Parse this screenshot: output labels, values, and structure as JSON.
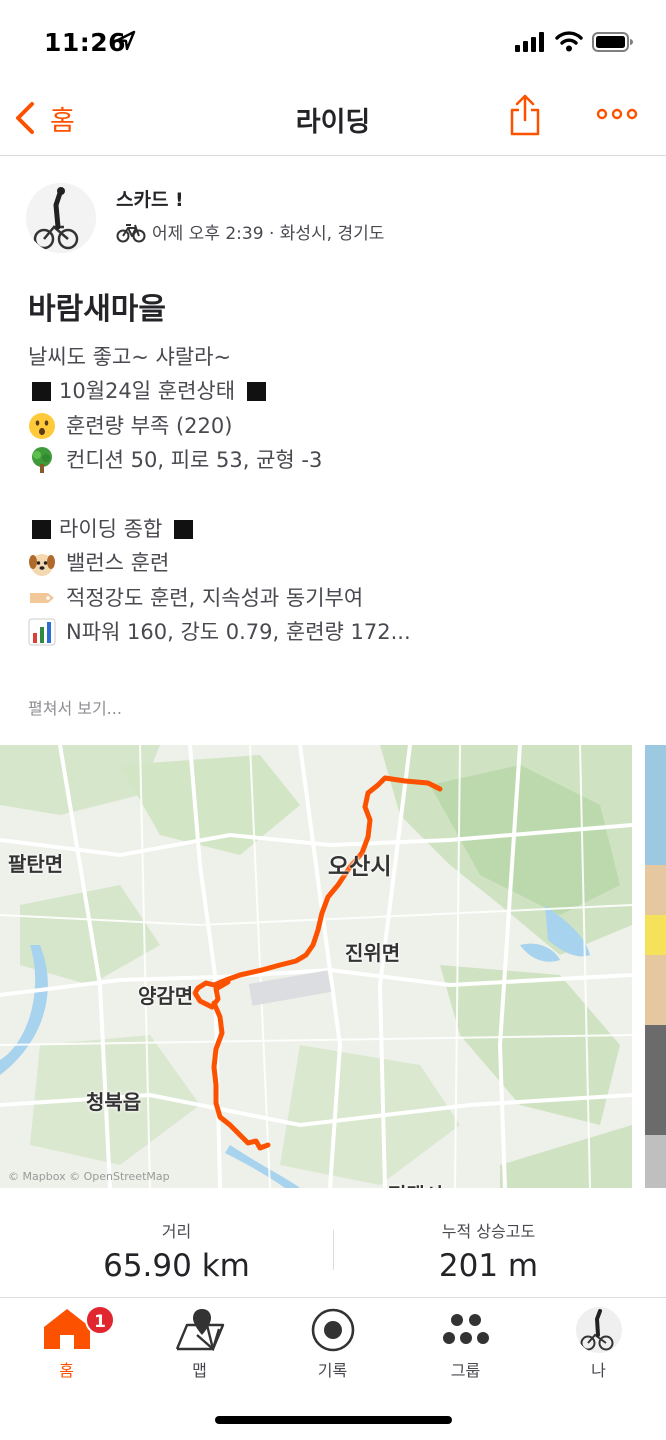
{
  "status_bar": {
    "time": "11:26"
  },
  "nav": {
    "back_label": "홈",
    "title": "라이딩"
  },
  "activity": {
    "athlete_name": "스카드 !",
    "meta": "어제 오후 2:39 · 화성시, 경기도",
    "title": "바람새마을",
    "description": [
      {
        "icon": "",
        "text": "날씨도 좋고~ 샤랄라~"
      },
      {
        "icon": "black-square",
        "text": "10월24일 훈련상태",
        "trail": true
      },
      {
        "icon": "hushed-face-emoji",
        "text": "훈련량 부족 (220)"
      },
      {
        "icon": "tree-emoji",
        "text": "컨디션 50, 피로 53, 균형 -3"
      },
      {
        "icon": "blank",
        "text": ""
      },
      {
        "icon": "black-square",
        "text": "라이딩 종합",
        "trail": true
      },
      {
        "icon": "dog-emoji",
        "text": "밸런스 훈련"
      },
      {
        "icon": "tag-emoji",
        "text": "적정강도 훈련, 지속성과 동기부여"
      },
      {
        "icon": "bar-chart-emoji",
        "text": "N파워 160, 강도 0.79, 훈련량 172..."
      }
    ],
    "expand_label": "펼쳐서 보기..."
  },
  "map": {
    "labels": {
      "paltan": "팔탄면",
      "osan": "오산시",
      "jiwi": "진위면",
      "yanggam": "양감면",
      "cheongbuk": "청북읍",
      "bottom": "평택시"
    },
    "attribution": "© Mapbox © OpenStreetMap",
    "route_color": "#fc5200"
  },
  "stats": [
    {
      "label": "거리",
      "value": "65.90 km"
    },
    {
      "label": "누적 상승고도",
      "value": "201 m"
    }
  ],
  "tabbar": {
    "badge": "1",
    "tabs": [
      {
        "label": "홈",
        "icon": "home-icon",
        "active": true
      },
      {
        "label": "맵",
        "icon": "map-pin-icon"
      },
      {
        "label": "기록",
        "icon": "record-icon"
      },
      {
        "label": "그룹",
        "icon": "groups-icon"
      },
      {
        "label": "나",
        "icon": "profile-avatar"
      }
    ]
  },
  "colors": {
    "accent": "#fc5200",
    "text": "#242428",
    "muted": "#494950"
  }
}
